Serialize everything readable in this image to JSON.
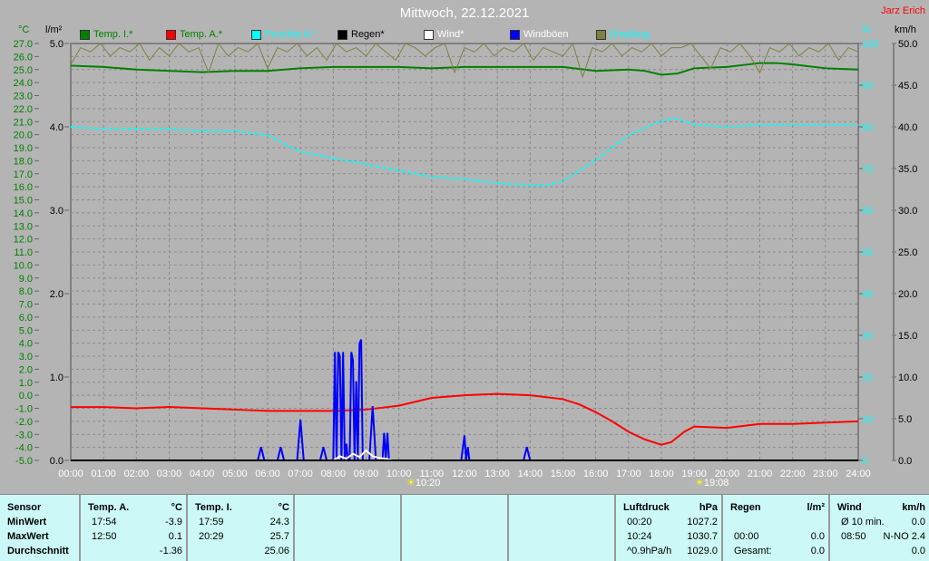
{
  "header": {
    "title": "Mittwoch, 22.12.2021",
    "author": "Jarz Erich"
  },
  "units": {
    "celsius": "°C",
    "rain": "l/m²",
    "percent": "%",
    "speed": "km/h"
  },
  "legend": [
    {
      "label": "Temp. I.*",
      "color": "#008000",
      "text_color": "#008000"
    },
    {
      "label": "Temp. A.*",
      "color": "#ff0000",
      "text_color": "#008000"
    },
    {
      "label": "Feuchte A.*",
      "color": "#00ffff",
      "text_color": "#00ffff"
    },
    {
      "label": "Regen*",
      "color": "#000000",
      "text_color": "#000000"
    },
    {
      "label": "Wind*",
      "color": "#ffffff",
      "text_color": "#ffffff"
    },
    {
      "label": "Windböen",
      "color": "#0000ff",
      "text_color": "#ffffff"
    },
    {
      "label": "Empfang",
      "color": "#808040",
      "text_color": "#00ffff"
    }
  ],
  "markers": {
    "sunrise": "10:20",
    "sunset": "19:08"
  },
  "chart_data": {
    "type": "line",
    "title": "Mittwoch, 22.12.2021",
    "x_range": [
      0,
      24
    ],
    "x_ticks": [
      "00:00",
      "01:00",
      "02:00",
      "03:00",
      "04:00",
      "05:00",
      "06:00",
      "07:00",
      "08:00",
      "09:00",
      "10:00",
      "11:00",
      "12:00",
      "13:00",
      "14:00",
      "15:00",
      "16:00",
      "17:00",
      "18:00",
      "19:00",
      "20:00",
      "21:00",
      "22:00",
      "23:00",
      "24:00"
    ],
    "axes": {
      "celsius": {
        "range": [
          -5,
          27
        ],
        "ticks": [
          "27.0",
          "26.0",
          "25.0",
          "24.0",
          "23.0",
          "22.0",
          "21.0",
          "20.0",
          "19.0",
          "18.0",
          "17.0",
          "16.0",
          "15.0",
          "14.0",
          "13.0",
          "12.0",
          "11.0",
          "10.0",
          "9.0",
          "8.0",
          "7.0",
          "6.0",
          "5.0",
          "4.0",
          "3.0",
          "2.0",
          "1.0",
          "0.0",
          "-1.0",
          "-2.0",
          "-3.0",
          "-4.0",
          "-5.0"
        ]
      },
      "rain": {
        "range": [
          0,
          5
        ],
        "ticks": [
          "5.0",
          "4.0",
          "3.0",
          "2.0",
          "1.0",
          "0.0"
        ]
      },
      "percent": {
        "range": [
          0,
          100
        ],
        "ticks": [
          "100",
          "90",
          "80",
          "70",
          "60",
          "50",
          "40",
          "30",
          "20",
          "10",
          "0"
        ]
      },
      "speed": {
        "range": [
          0,
          50
        ],
        "ticks": [
          "50.0",
          "45.0",
          "40.0",
          "35.0",
          "30.0",
          "25.0",
          "20.0",
          "15.0",
          "10.0",
          "5.0",
          "0.0"
        ]
      }
    },
    "series": [
      {
        "name": "Temp. I.*",
        "axis": "celsius",
        "color": "#008000",
        "x": [
          0,
          1,
          2,
          3,
          4,
          5,
          6,
          7,
          8,
          9,
          10,
          11,
          12,
          13,
          14,
          15,
          16,
          17,
          17.5,
          18,
          18.5,
          19,
          20,
          21,
          21.5,
          22,
          23,
          24
        ],
        "y": [
          25.3,
          25.2,
          25.0,
          24.9,
          24.8,
          24.9,
          24.9,
          25.1,
          25.2,
          25.2,
          25.2,
          25.1,
          25.2,
          25.2,
          25.2,
          25.2,
          24.9,
          25.0,
          24.9,
          24.6,
          24.7,
          25.1,
          25.2,
          25.5,
          25.5,
          25.4,
          25.1,
          25.0
        ]
      },
      {
        "name": "Temp. A.*",
        "axis": "celsius",
        "color": "#ff0000",
        "x": [
          0,
          1,
          2,
          3,
          4,
          5,
          6,
          7,
          8,
          9,
          10,
          11,
          12,
          13,
          14,
          15,
          15.5,
          16,
          16.5,
          17,
          17.5,
          18,
          18.3,
          18.7,
          19,
          20,
          21,
          22,
          23,
          24
        ],
        "y": [
          -0.9,
          -0.9,
          -1.0,
          -0.9,
          -1.0,
          -1.1,
          -1.2,
          -1.2,
          -1.2,
          -1.1,
          -0.8,
          -0.2,
          0.0,
          0.1,
          0.0,
          -0.3,
          -0.7,
          -1.3,
          -2.0,
          -2.8,
          -3.4,
          -3.8,
          -3.6,
          -2.8,
          -2.4,
          -2.5,
          -2.2,
          -2.2,
          -2.1,
          -2.0
        ]
      },
      {
        "name": "Feuchte A.*",
        "axis": "percent",
        "color": "#00ffff",
        "dashed": true,
        "x": [
          0,
          1,
          2,
          3,
          4,
          5,
          6,
          7,
          8,
          9,
          10,
          11,
          12,
          13,
          14,
          14.5,
          15,
          16,
          17,
          18,
          18.5,
          19,
          20,
          21,
          22,
          23,
          24
        ],
        "y": [
          80,
          79.5,
          79.5,
          79.5,
          79,
          79,
          78,
          74,
          72.5,
          71,
          69.5,
          68,
          67.5,
          66.5,
          66,
          66,
          67,
          72,
          78,
          81.5,
          82,
          80.5,
          80,
          80.5,
          80.5,
          80.5,
          80.5
        ]
      },
      {
        "name": "Windböen",
        "axis": "speed",
        "color": "#0000ff",
        "x": [
          5.7,
          5.8,
          5.9,
          6.3,
          6.4,
          6.5,
          6.9,
          7.0,
          7.1,
          7.6,
          7.7,
          7.8,
          8.0,
          8.05,
          8.1,
          8.15,
          8.2,
          8.25,
          8.3,
          8.35,
          8.4,
          8.45,
          8.5,
          8.55,
          8.6,
          8.65,
          8.7,
          8.75,
          8.8,
          8.85,
          8.9,
          9.0,
          9.05,
          9.1,
          9.2,
          9.3,
          9.35,
          9.4,
          9.5,
          9.55,
          9.6,
          9.65,
          9.7,
          9.75,
          9.8,
          9.85,
          9.9,
          11.9,
          12.0,
          12.05,
          12.1,
          12.15,
          12.2,
          13.8,
          13.9,
          14.0,
          14.1
        ],
        "y": [
          0,
          1.6,
          0,
          0,
          1.6,
          0,
          0,
          4.9,
          0,
          0,
          1.6,
          0,
          0,
          13.0,
          0,
          13.0,
          12.5,
          0,
          13.0,
          0,
          2.0,
          0,
          0,
          13.0,
          12.0,
          0,
          9.5,
          0,
          14.0,
          14.5,
          0,
          0,
          0,
          0,
          6.5,
          0,
          0,
          0,
          0,
          3.3,
          0,
          3.3,
          0,
          0,
          0,
          0,
          0,
          0,
          3.0,
          0,
          1.6,
          0,
          0,
          0,
          1.6,
          0,
          0
        ]
      },
      {
        "name": "Wind*",
        "axis": "speed",
        "color": "#ffffff",
        "x": [
          8.0,
          8.2,
          8.4,
          8.6,
          8.8,
          9.0,
          9.2,
          9.4,
          9.6,
          9.8
        ],
        "y": [
          0,
          0.5,
          0.2,
          0.8,
          0.4,
          1.2,
          0.5,
          0.3,
          0.2,
          0
        ]
      },
      {
        "name": "Regen*",
        "axis": "rain",
        "color": "#000000",
        "x": [
          0,
          24
        ],
        "y": [
          0,
          0
        ]
      },
      {
        "name": "Empfang",
        "axis": "percent",
        "color": "#808040",
        "x": [
          0,
          0.3,
          0.6,
          0.9,
          1.2,
          1.5,
          1.8,
          2.1,
          2.4,
          2.7,
          3.0,
          3.3,
          3.6,
          3.9,
          4.2,
          4.5,
          4.8,
          5.1,
          5.4,
          5.7,
          6.0,
          6.3,
          6.6,
          6.9,
          7.2,
          7.5,
          7.8,
          8.1,
          8.4,
          8.7,
          9.0,
          9.3,
          9.6,
          9.9,
          10.2,
          10.5,
          10.8,
          11.1,
          11.4,
          11.7,
          12.0,
          12.3,
          12.6,
          12.9,
          13.2,
          13.5,
          13.8,
          14.1,
          14.4,
          14.7,
          15.0,
          15.3,
          15.6,
          15.9,
          16.2,
          16.5,
          16.8,
          17.1,
          17.4,
          17.7,
          18.0,
          18.3,
          18.6,
          18.9,
          19.2,
          19.5,
          19.8,
          20.1,
          20.4,
          20.7,
          21.0,
          21.3,
          21.6,
          21.9,
          22.2,
          22.5,
          22.8,
          23.1,
          23.4,
          23.7,
          24
        ],
        "y": [
          95,
          99,
          98,
          100,
          97,
          99,
          98,
          100,
          96,
          99,
          97,
          100,
          98,
          99,
          93,
          100,
          97,
          99,
          98,
          100,
          94,
          99,
          98,
          100,
          97,
          99,
          96,
          100,
          98,
          99,
          97,
          100,
          98,
          96,
          100,
          99,
          97,
          99,
          100,
          93,
          99,
          98,
          100,
          97,
          99,
          98,
          100,
          96,
          99,
          98,
          97,
          100,
          92,
          99,
          98,
          100,
          97,
          99,
          98,
          100,
          97,
          99,
          99,
          100,
          97,
          94,
          99,
          98,
          100,
          97,
          93,
          99,
          98,
          100,
          97,
          99,
          98,
          100,
          96,
          99,
          98
        ]
      }
    ]
  },
  "stats": {
    "sensor": {
      "header": "Sensor",
      "rows": [
        "MinWert",
        "MaxWert",
        "Durchschnitt"
      ]
    },
    "temp_a": {
      "header": "Temp. A.",
      "unit": "°C",
      "rows": [
        [
          "17:54",
          "-3.9"
        ],
        [
          "12:50",
          "0.1"
        ],
        [
          "",
          "-1.36"
        ]
      ]
    },
    "temp_i": {
      "header": "Temp. I.",
      "unit": "°C",
      "rows": [
        [
          "17:59",
          "24.3"
        ],
        [
          "20:29",
          "25.7"
        ],
        [
          "",
          "25.06"
        ]
      ]
    },
    "pressure": {
      "header": "Luftdruck",
      "unit": "hPa",
      "rows": [
        [
          "00:20",
          "1027.2"
        ],
        [
          "10:24",
          "1030.7"
        ],
        [
          "^0.9hPa/h",
          "1029.0"
        ]
      ]
    },
    "rain": {
      "header": "Regen",
      "unit": "l/m²",
      "rows": [
        [
          "",
          ""
        ],
        [
          "00:00",
          "0.0"
        ],
        [
          "Gesamt:",
          "0.0"
        ]
      ]
    },
    "wind": {
      "header": "Wind",
      "unit": "km/h",
      "rows": [
        [
          "Ø 10 min.",
          "0.0"
        ],
        [
          "08:50",
          "N-NO 2.4"
        ],
        [
          "",
          "0.0"
        ]
      ]
    }
  }
}
